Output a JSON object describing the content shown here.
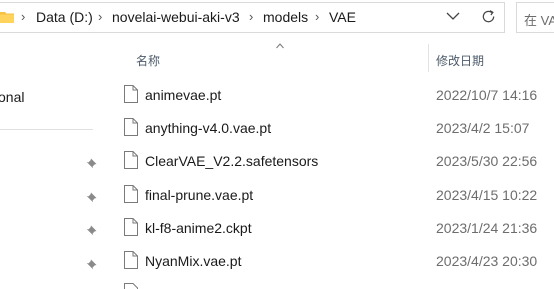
{
  "address_bar": {
    "crumbs": [
      "Data (D:)",
      "novelai-webui-aki-v3",
      "models",
      "VAE"
    ],
    "separator": "›"
  },
  "search": {
    "placeholder": "在 VAE"
  },
  "navigation": {
    "partial_item": "onal"
  },
  "columns": {
    "name": "名称",
    "modified": "修改日期"
  },
  "files": [
    {
      "name": "animevae.pt",
      "modified": "2022/10/7 14:16"
    },
    {
      "name": "anything-v4.0.vae.pt",
      "modified": "2023/4/2 15:07"
    },
    {
      "name": "ClearVAE_V2.2.safetensors",
      "modified": "2023/5/30 22:56"
    },
    {
      "name": "final-prune.vae.pt",
      "modified": "2023/4/15 10:22"
    },
    {
      "name": "kl-f8-anime2.ckpt",
      "modified": "2023/1/24 21:36"
    },
    {
      "name": "NyanMix.vae.pt",
      "modified": "2023/4/23 20:30"
    }
  ],
  "icons": {
    "folder": "folder-icon",
    "dropdown": "chevron-down-icon",
    "refresh": "refresh-icon",
    "pin": "pin-icon",
    "file": "file-icon",
    "sort": "sort-ascending-icon"
  },
  "colors": {
    "folder": "#f5c242",
    "header_text": "#4d5b6a",
    "date_text": "#6d6d6d"
  }
}
